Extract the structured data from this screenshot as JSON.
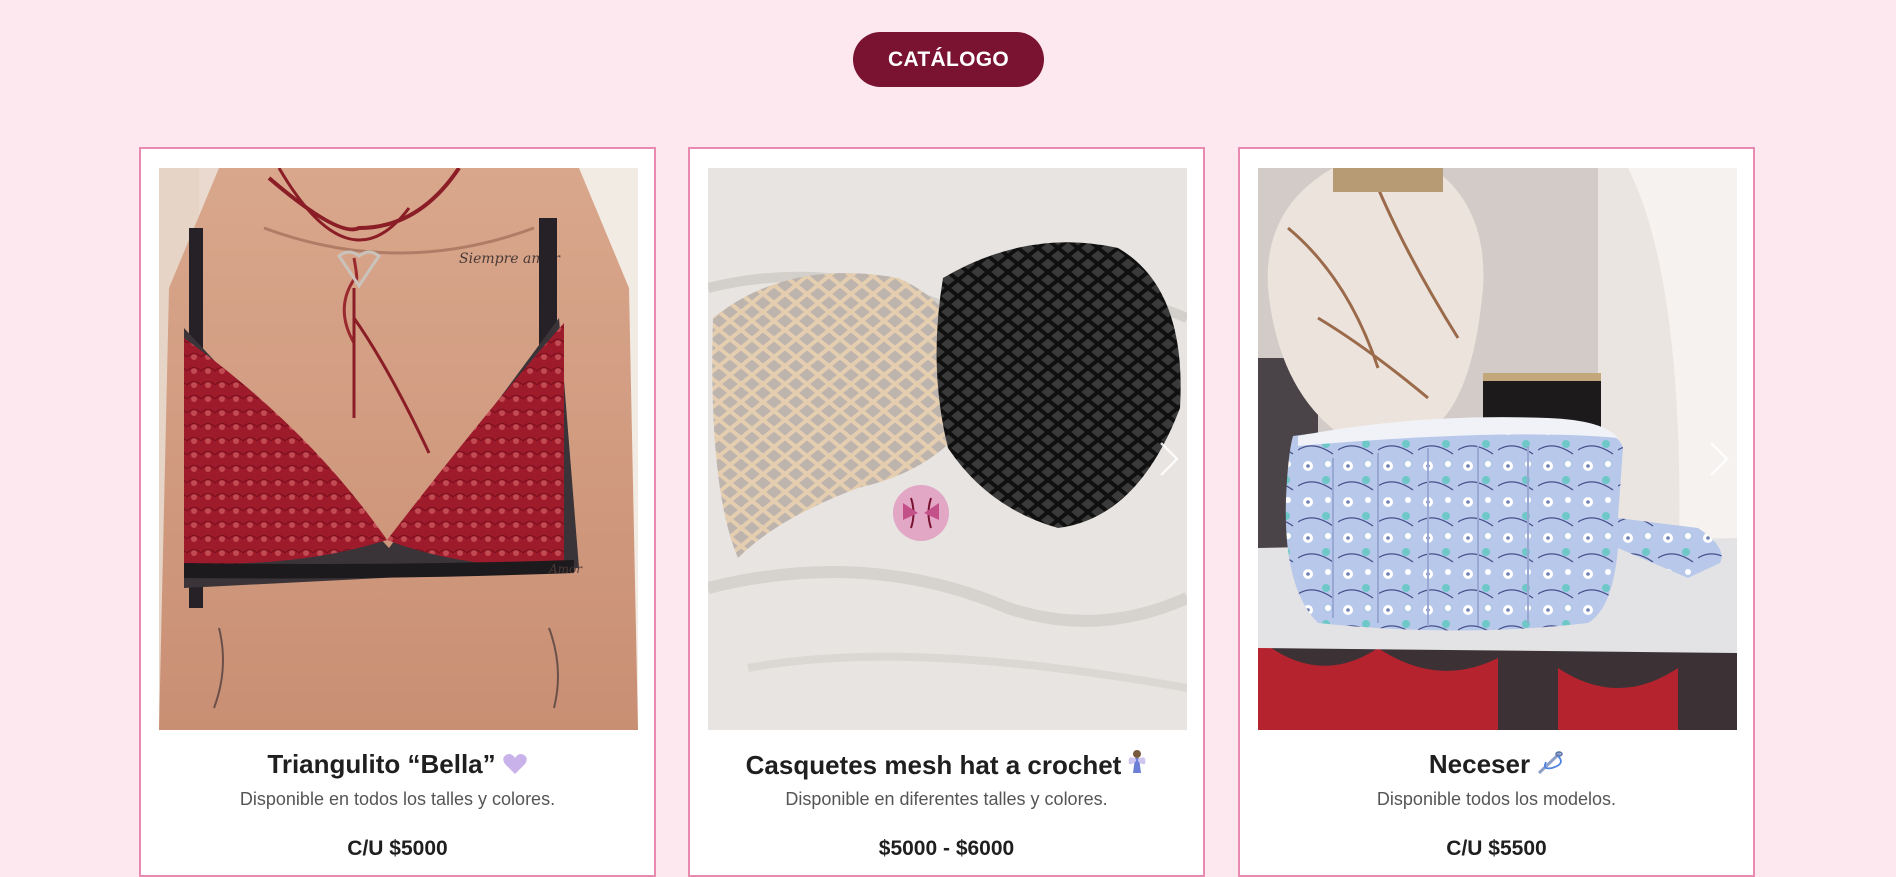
{
  "header": {
    "catalog_button_label": "CATÁLOGO"
  },
  "colors": {
    "page_background": "#fce8ee",
    "accent": "#7a1232",
    "card_border": "#e98bb0"
  },
  "products": [
    {
      "title": "Triangulito “Bella”",
      "emoji_icon": "purple-heart-icon",
      "description": "Disponible en todos los talles y colores.",
      "price": "C/U $5000",
      "image_subject": "red-lace-bralette-photo",
      "has_next_arrow": false
    },
    {
      "title": "Casquetes mesh hat a crochet",
      "emoji_icon": "fairy-icon",
      "description": "Disponible en diferentes talles y colores.",
      "price": "$5000 - $6000",
      "image_subject": "crochet-mesh-hats-photo",
      "has_next_arrow": true
    },
    {
      "title": "Neceser",
      "emoji_icon": "sewing-needle-icon",
      "description": "Disponible todos los modelos.",
      "price": "C/U $5500",
      "image_subject": "floral-toiletry-bag-photo",
      "has_next_arrow": true
    }
  ]
}
